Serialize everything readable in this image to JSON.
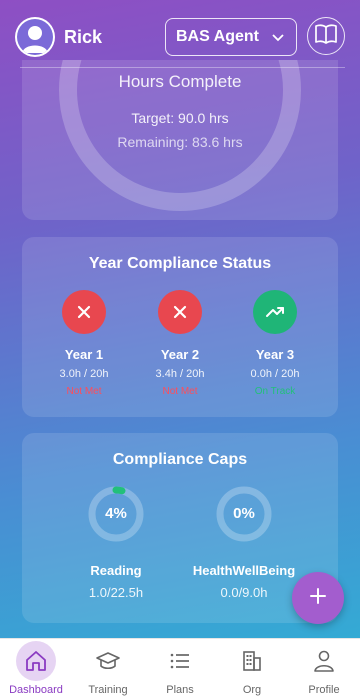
{
  "header": {
    "user_name": "Rick",
    "role_selected": "BAS Agent"
  },
  "hours": {
    "title": "Hours Complete",
    "target": "Target: 90.0 hrs",
    "remaining": "Remaining: 83.6 hrs"
  },
  "year_compliance": {
    "title": "Year Compliance Status",
    "years": [
      {
        "label": "Year 1",
        "hours": "3.0h / 20h",
        "status": "Not Met",
        "status_color": "#ff4d5a",
        "icon": "close-icon",
        "icon_bg": "#e8474f"
      },
      {
        "label": "Year 2",
        "hours": "3.4h / 20h",
        "status": "Not Met",
        "status_color": "#ff4d5a",
        "icon": "close-icon",
        "icon_bg": "#e8474f"
      },
      {
        "label": "Year 3",
        "hours": "0.0h / 20h",
        "status": "On Track",
        "status_color": "#22c07a",
        "icon": "trending-up-icon",
        "icon_bg": "#1fb577"
      }
    ]
  },
  "caps": {
    "title": "Compliance Caps",
    "items": [
      {
        "label": "Reading",
        "percent_text": "4%",
        "percent": 4,
        "value": "1.0/22.5h"
      },
      {
        "label": "HealthWellBeing",
        "percent_text": "0%",
        "percent": 0,
        "value": "0.0/9.0h"
      }
    ]
  },
  "nav": {
    "items": [
      {
        "label": "Dashboard",
        "icon": "home-icon",
        "active": true
      },
      {
        "label": "Training",
        "icon": "graduation-cap-icon",
        "active": false
      },
      {
        "label": "Plans",
        "icon": "list-icon",
        "active": false
      },
      {
        "label": "Org",
        "icon": "building-icon",
        "active": false
      },
      {
        "label": "Profile",
        "icon": "person-icon",
        "active": false
      }
    ]
  },
  "colors": {
    "accent": "#8a3bc2",
    "fab": "#a35dce",
    "progress": "#22c07a"
  }
}
